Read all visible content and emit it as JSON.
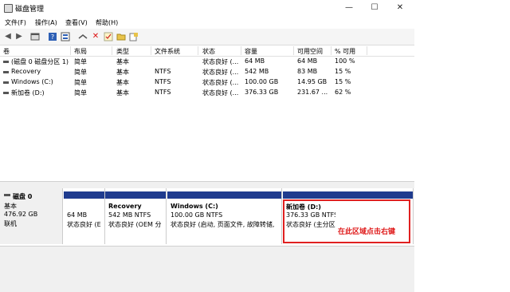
{
  "window": {
    "title": "磁盘管理",
    "controls": {
      "minimize": "—",
      "maximize": "☐",
      "close": "✕"
    }
  },
  "menu": [
    "文件(F)",
    "操作(A)",
    "查看(V)",
    "帮助(H)"
  ],
  "toolbar_icons": [
    "back-icon",
    "forward-icon",
    "console-icon",
    "help-icon",
    "properties-icon",
    "connect-icon",
    "delete-icon",
    "check-icon",
    "folder-icon",
    "search-icon"
  ],
  "columns": [
    "卷",
    "布局",
    "类型",
    "文件系统",
    "状态",
    "容量",
    "可用空间",
    "% 可用"
  ],
  "volumes": [
    {
      "name": "(磁盘 0 磁盘分区 1)",
      "layout": "简单",
      "type": "基本",
      "fs": "",
      "status": "状态良好 (...",
      "capacity": "64 MB",
      "free": "64 MB",
      "pct": "100 %"
    },
    {
      "name": "Recovery",
      "layout": "简单",
      "type": "基本",
      "fs": "NTFS",
      "status": "状态良好 (...",
      "capacity": "542 MB",
      "free": "83 MB",
      "pct": "15 %"
    },
    {
      "name": "Windows (C:)",
      "layout": "简单",
      "type": "基本",
      "fs": "NTFS",
      "status": "状态良好 (...",
      "capacity": "100.00 GB",
      "free": "14.95 GB",
      "pct": "15 %"
    },
    {
      "name": "新加卷 (D:)",
      "layout": "简单",
      "type": "基本",
      "fs": "NTFS",
      "status": "状态良好 (...",
      "capacity": "376.33 GB",
      "free": "231.67 ...",
      "pct": "62 %"
    }
  ],
  "disk": {
    "name": "磁盘 0",
    "type": "基本",
    "size": "476.92 GB",
    "state": "联机",
    "partitions": [
      {
        "title": "",
        "line1": "64 MB",
        "line2": "状态良好 (E"
      },
      {
        "title": "Recovery",
        "line1": "542 MB NTFS",
        "line2": "状态良好 (OEM 分"
      },
      {
        "title": "Windows  (C:)",
        "line1": "100.00 GB NTFS",
        "line2": "状态良好 (启动, 页面文件, 故障转储,"
      },
      {
        "title": "新加卷  (D:)",
        "line1": "376.33 GB NTFS",
        "line2": "状态良好 (主分区"
      }
    ]
  },
  "annotation": "在此区域点击右键",
  "colors": {
    "partition_bar": "#1f3b8e",
    "highlight": "#e02020"
  }
}
